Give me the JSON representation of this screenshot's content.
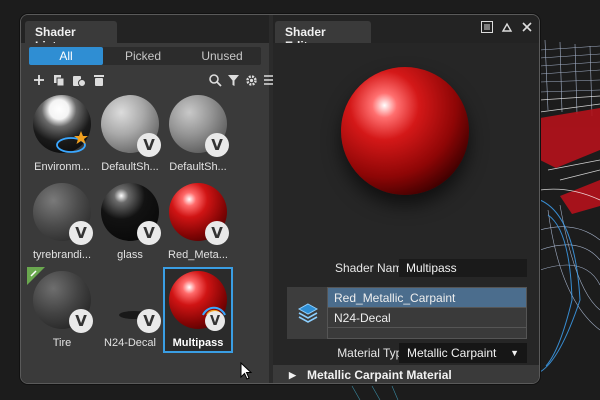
{
  "lister": {
    "title": "Shader Lister",
    "filters": [
      "All",
      "Picked",
      "Unused"
    ],
    "active_filter": "All",
    "toolbar_icons": [
      "plus-icon",
      "duplicate-icon",
      "delete-unused-icon",
      "trash-icon",
      "search-icon",
      "filter-icon",
      "settings-icon",
      "menu-icon"
    ],
    "shaders": [
      {
        "label": "Environm...",
        "kind": "environment"
      },
      {
        "label": "DefaultSh...",
        "kind": "grey"
      },
      {
        "label": "DefaultSh...",
        "kind": "grey"
      },
      {
        "label": "tyrebrandi...",
        "kind": "darkgrey"
      },
      {
        "label": "glass",
        "kind": "black"
      },
      {
        "label": "Red_Meta...",
        "kind": "red"
      },
      {
        "label": "Tire",
        "kind": "darkgrey"
      },
      {
        "label": "N24-Decal",
        "kind": "decal"
      },
      {
        "label": "Multipass",
        "kind": "red",
        "selected": true
      }
    ]
  },
  "editor": {
    "title": "Shader Editor",
    "shader_name_label": "Shader Name",
    "shader_name_value": "Multipass",
    "layers": [
      "Red_Metallic_Carpaint",
      "N24-Decal"
    ],
    "selected_layer": "Red_Metallic_Carpaint",
    "material_type_label": "Material Type",
    "material_type_value": "Metallic Carpaint",
    "section_title": "Metallic Carpaint Material"
  },
  "colors": {
    "accent": "#2f8ed3",
    "selected_row": "#4b6d8d",
    "panel_bg": "#3a3a3a"
  }
}
